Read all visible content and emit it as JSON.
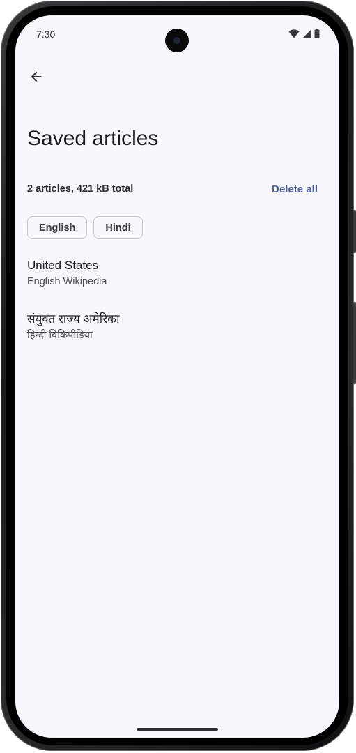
{
  "status_bar": {
    "time": "7:30",
    "icons": [
      "wifi-icon",
      "cell-signal-icon",
      "battery-icon"
    ]
  },
  "toolbar": {
    "back_icon": "arrow-left-icon"
  },
  "page": {
    "title": "Saved articles",
    "summary": "2 articles, 421 kB total",
    "delete_all_label": "Delete all"
  },
  "filters": [
    {
      "label": "English"
    },
    {
      "label": "Hindi"
    }
  ],
  "articles": [
    {
      "title": "United States",
      "source": "English Wikipedia"
    },
    {
      "title": "संयुक्त राज्य अमेरिका",
      "source": "हिन्दी विकिपीडिया"
    }
  ],
  "colors": {
    "background": "#f8f7fd",
    "accent": "#4a5c92",
    "text_primary": "#1b1b1f"
  }
}
